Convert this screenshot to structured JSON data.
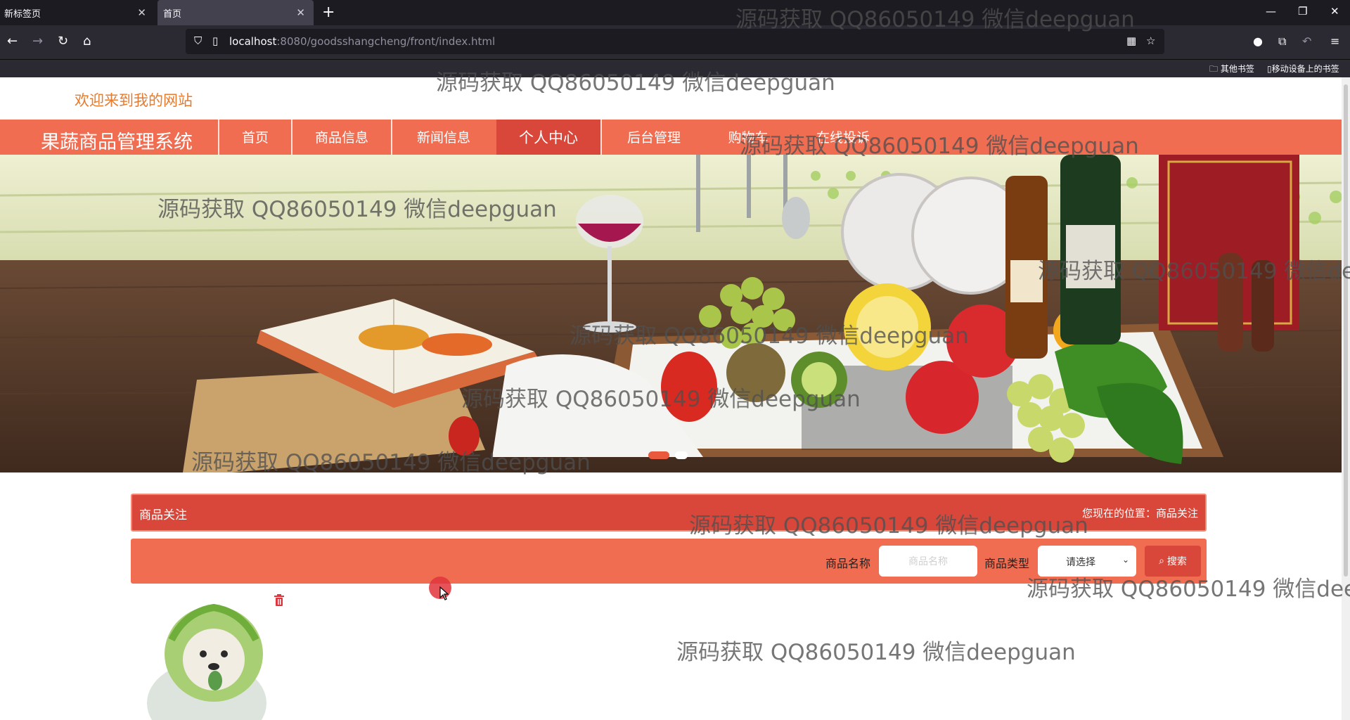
{
  "browser": {
    "tabs": [
      {
        "title": "新标签页",
        "active": false
      },
      {
        "title": "首页",
        "active": true
      }
    ],
    "url": {
      "host": "localhost",
      "rest": ":8080/goodsshangcheng/front/index.html"
    },
    "bookmarks": [
      "其他书签",
      "移动设备上的书签"
    ]
  },
  "site": {
    "welcome": "欢迎来到我的网站",
    "title": "果蔬商品管理系统",
    "nav": [
      "首页",
      "商品信息",
      "新闻信息",
      "个人中心",
      "后台管理",
      "购物车",
      "在线投诉"
    ],
    "active_nav": "个人中心"
  },
  "panel": {
    "title": "商品关注",
    "breadcrumb": "您现在的位置：商品关注"
  },
  "search": {
    "name_label": "商品名称",
    "name_placeholder": "商品名称",
    "type_label": "商品类型",
    "type_value": "请选择",
    "button": "搜索"
  },
  "watermark": "源码获取 QQ86050149 微信deepguan",
  "colors": {
    "nav": "#f06d51",
    "active": "#d9473b",
    "welcome": "#e77b2f"
  }
}
